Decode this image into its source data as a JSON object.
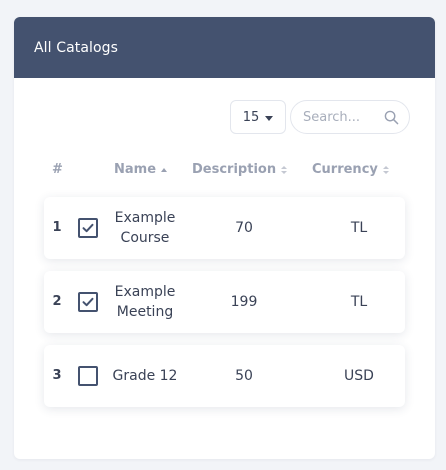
{
  "card": {
    "title": "All Catalogs"
  },
  "toolbar": {
    "page_size": "15",
    "search_placeholder": "Search..."
  },
  "table": {
    "headers": {
      "index": "#",
      "name": "Name",
      "description": "Description",
      "currency": "Currency"
    },
    "rows": [
      {
        "index": "1",
        "checked": true,
        "name": "Example Course",
        "description": "70",
        "currency": "TL"
      },
      {
        "index": "2",
        "checked": true,
        "name": "Example Meeting",
        "description": "199",
        "currency": "TL"
      },
      {
        "index": "3",
        "checked": false,
        "name": "Grade 12",
        "description": "50",
        "currency": "USD"
      }
    ]
  },
  "colors": {
    "header_bg": "#44526f",
    "checkbox": "#44526f",
    "page_bg": "#f2f4f8"
  }
}
